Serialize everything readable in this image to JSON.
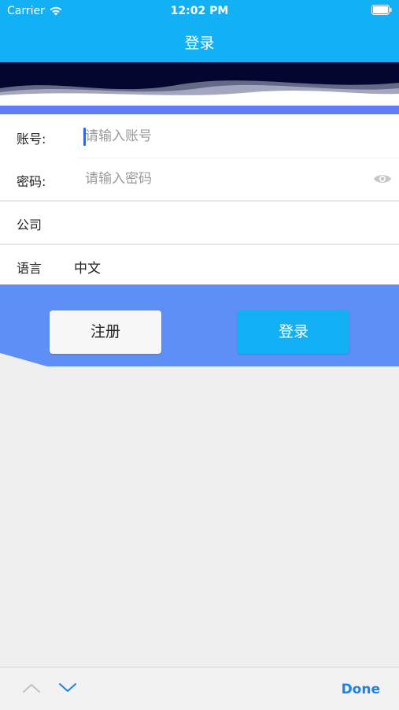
{
  "status_bar": {
    "carrier": "Carrier",
    "time": "12:02 PM"
  },
  "nav": {
    "title": "登录"
  },
  "form": {
    "account": {
      "label": "账号:",
      "placeholder": "请输入账号",
      "value": ""
    },
    "password": {
      "label": "密码:",
      "placeholder": "请输入密码",
      "value": ""
    },
    "company": {
      "label": "公司",
      "value": ""
    },
    "language": {
      "label": "语言",
      "value": "中文"
    }
  },
  "buttons": {
    "register": "注册",
    "login": "登录"
  },
  "accessory": {
    "done": "Done"
  },
  "colors": {
    "primary": "#12b0f5",
    "accent_blue": "#5d8ff7",
    "link": "#1a82e8"
  },
  "icons": [
    "wifi-icon",
    "battery-icon",
    "eye-icon",
    "chevron-up-icon",
    "chevron-down-icon"
  ]
}
